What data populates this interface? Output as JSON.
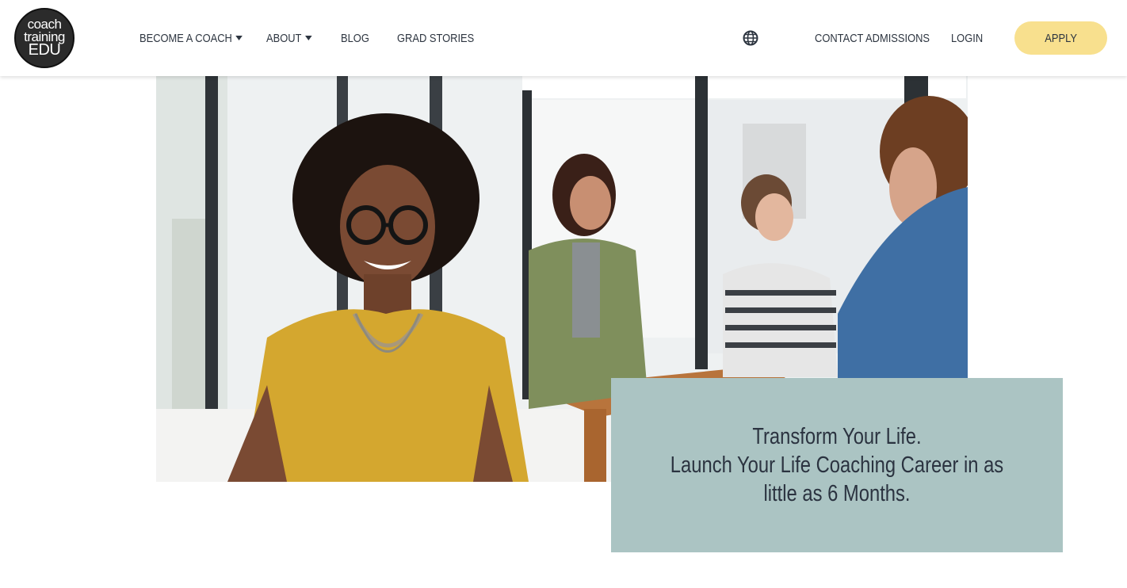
{
  "brand": {
    "logo_line1": "coach",
    "logo_line2": "training",
    "logo_line3": "EDU"
  },
  "nav": {
    "become_coach": "BECOME A COACH",
    "about": "ABOUT",
    "blog": "BLOG",
    "grad_stories": "GRAD STORIES",
    "contact_admissions": "CONTACT ADMISSIONS",
    "login": "LOGIN",
    "apply": "APPLY",
    "language_icon": "globe-icon"
  },
  "hero": {
    "tagline_line1": "Transform Your Life.",
    "tagline_line2": "Launch Your Life Coaching Career in as",
    "tagline_line3": "little as 6 Months."
  },
  "colors": {
    "apply_button": "#f8e08e",
    "tagline_box": "#abc4c3",
    "text": "#2d3540"
  }
}
